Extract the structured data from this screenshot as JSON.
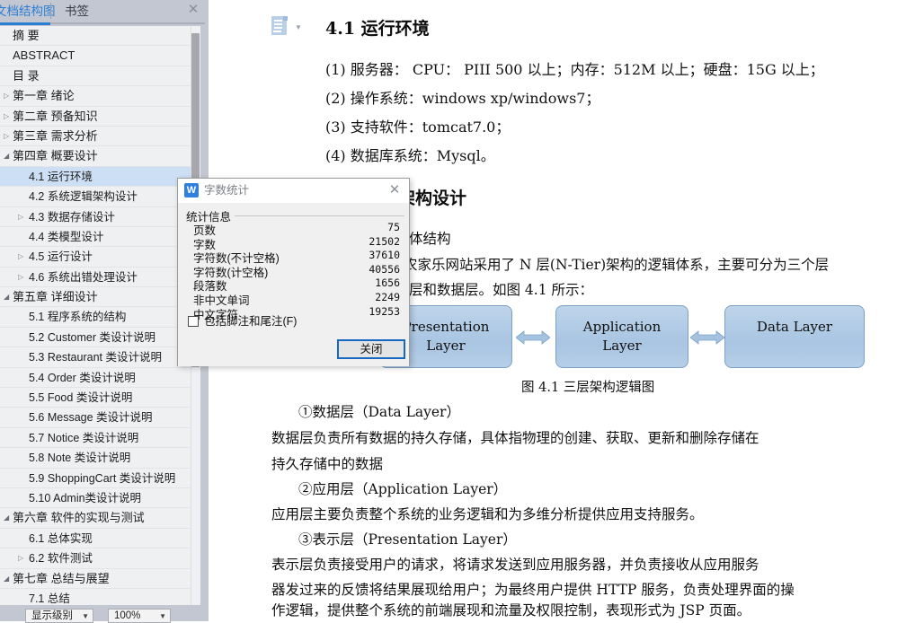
{
  "nav": {
    "tabs": [
      {
        "label": "文档结构图",
        "active": true
      },
      {
        "label": "书签",
        "active": false
      }
    ],
    "close_glyph": "✕",
    "items": [
      {
        "label": "摘   要",
        "level": 1,
        "marker": "none",
        "selected": false
      },
      {
        "label": "ABSTRACT",
        "level": 1,
        "marker": "none",
        "selected": false
      },
      {
        "label": "目   录",
        "level": 1,
        "marker": "none",
        "selected": false
      },
      {
        "label": "第一章  绪论",
        "level": 1,
        "marker": "collapsed",
        "selected": false
      },
      {
        "label": "第二章  预备知识",
        "level": 1,
        "marker": "collapsed",
        "selected": false
      },
      {
        "label": "第三章  需求分析",
        "level": 1,
        "marker": "collapsed",
        "selected": false
      },
      {
        "label": "第四章  概要设计",
        "level": 1,
        "marker": "expanded",
        "selected": false
      },
      {
        "label": "4.1  运行环境",
        "level": 2,
        "marker": "none",
        "selected": true
      },
      {
        "label": "4.2  系统逻辑架构设计",
        "level": 2,
        "marker": "none",
        "selected": false
      },
      {
        "label": "4.3  数据存储设计",
        "level": 2,
        "marker": "collapsed",
        "selected": false
      },
      {
        "label": "4.4  类模型设计",
        "level": 2,
        "marker": "none",
        "selected": false
      },
      {
        "label": "4.5  运行设计",
        "level": 2,
        "marker": "collapsed",
        "selected": false
      },
      {
        "label": "4.6  系统出错处理设计",
        "level": 2,
        "marker": "collapsed",
        "selected": false
      },
      {
        "label": "第五章   详细设计",
        "level": 1,
        "marker": "expanded",
        "selected": false
      },
      {
        "label": "5.1  程序系统的结构",
        "level": 2,
        "marker": "none",
        "selected": false
      },
      {
        "label": "5.2 Customer 类设计说明",
        "level": 2,
        "marker": "none",
        "selected": false
      },
      {
        "label": "5.3 Restaurant 类设计说明",
        "level": 2,
        "marker": "none",
        "selected": false
      },
      {
        "label": "5.4 Order 类设计说明",
        "level": 2,
        "marker": "none",
        "selected": false
      },
      {
        "label": "5.5 Food 类设计说明",
        "level": 2,
        "marker": "none",
        "selected": false
      },
      {
        "label": "5.6 Message 类设计说明",
        "level": 2,
        "marker": "none",
        "selected": false
      },
      {
        "label": "5.7 Notice 类设计说明",
        "level": 2,
        "marker": "none",
        "selected": false
      },
      {
        "label": "5.8 Note 类设计说明",
        "level": 2,
        "marker": "none",
        "selected": false
      },
      {
        "label": "5.9 ShoppingCart 类设计说明",
        "level": 2,
        "marker": "none",
        "selected": false
      },
      {
        "label": "5.10 Admin类设计说明",
        "level": 2,
        "marker": "none",
        "selected": false
      },
      {
        "label": "第六章  软件的实现与测试",
        "level": 1,
        "marker": "expanded",
        "selected": false
      },
      {
        "label": "6.1  总体实现",
        "level": 2,
        "marker": "none",
        "selected": false
      },
      {
        "label": "6.2  软件测试",
        "level": 2,
        "marker": "collapsed",
        "selected": false
      },
      {
        "label": "第七章  总结与展望",
        "level": 1,
        "marker": "expanded",
        "selected": false
      },
      {
        "label": "7.1  总结",
        "level": 2,
        "marker": "none",
        "selected": false
      }
    ],
    "bottom": {
      "level_dropdown": "显示级别",
      "zoom_dropdown": "100%",
      "arrow_glyph": "▼"
    }
  },
  "document": {
    "paste_icon_arrow": "▼",
    "heading_41": "4.1 运行环境",
    "list_items": [
      "(1) 服务器：    CPU：   PIII 500 以上；内存：512M 以上；硬盘：15G 以上；",
      "(2) 操作系统：windows xp/windows7；",
      "(3) 支持软件：tomcat7.0；",
      "(4) 数据库系统：Mysql。"
    ],
    "heading_42": "4.2 系统逻辑架构设计",
    "heading_42_visible": "辑架构设计",
    "para_42_line1_visible": "的主体结构",
    "para_42_line2_visible": "现的农家乐网站采用了 N 层(N-Tier)架构的逻辑体系，主要可分为三个层",
    "para_42_line3_visible": "应用层和数据层。如图 4.1 所示：",
    "diagram": {
      "boxes": [
        "Presentation\nLayer",
        "Application\nLayer",
        "Data   Layer"
      ],
      "box_labels": [
        {
          "line1": "Presentation",
          "line2": "Layer"
        },
        {
          "line1": "Application",
          "line2": "Layer"
        },
        {
          "line1": "Data   Layer",
          "line2": ""
        }
      ],
      "caption": "图 4.1 三层架构逻辑图",
      "box_fill": "#aec8e4",
      "box_border": "#7da2c6",
      "arrow_fill": "#9fbfde"
    },
    "sections": [
      "①数据层（Data Layer）",
      "    数据层负责所有数据的持久存储，具体指物理的创建、获取、更新和删除存储在",
      "持久存储中的数据",
      "②应用层（Application Layer）",
      "    应用层主要负责整个系统的业务逻辑和为多维分析提供应用支持服务。",
      "③表示层（Presentation Layer）",
      "    表示层负责接受用户的请求，将请求发送到应用服务器，并负责接收从应用服务",
      "器发过来的反馈将结果展现给用户；为最终用户提供 HTTP 服务，负责处理界面的操",
      "作逻辑，提供整个系统的前端展现和流量及权限控制，表现形式为 JSP 页面。"
    ]
  },
  "word_count_dialog": {
    "title": "字数统计",
    "logo_letter": "W",
    "close_glyph": "✕",
    "group_label": "统计信息",
    "stats": [
      {
        "label": "页数",
        "value": "75"
      },
      {
        "label": "字数",
        "value": "21502"
      },
      {
        "label": "字符数(不计空格)",
        "value": "37610"
      },
      {
        "label": "字符数(计空格)",
        "value": "40556"
      },
      {
        "label": "段落数",
        "value": "1656"
      },
      {
        "label": "非中文单词",
        "value": "2249"
      },
      {
        "label": "中文字符",
        "value": "19253"
      }
    ],
    "checkbox_label": "包括脚注和尾注(F)",
    "checkbox_checked": false,
    "close_button": "关闭"
  },
  "colors": {
    "accent_blue": "#2a7fd4",
    "nav_chrome": "#c3c7d1",
    "nav_list_bg": "#eef0f2",
    "selection_blue": "#cddff4",
    "dialog_bg": "#f0f0f0",
    "focus_border": "#1667c2"
  }
}
